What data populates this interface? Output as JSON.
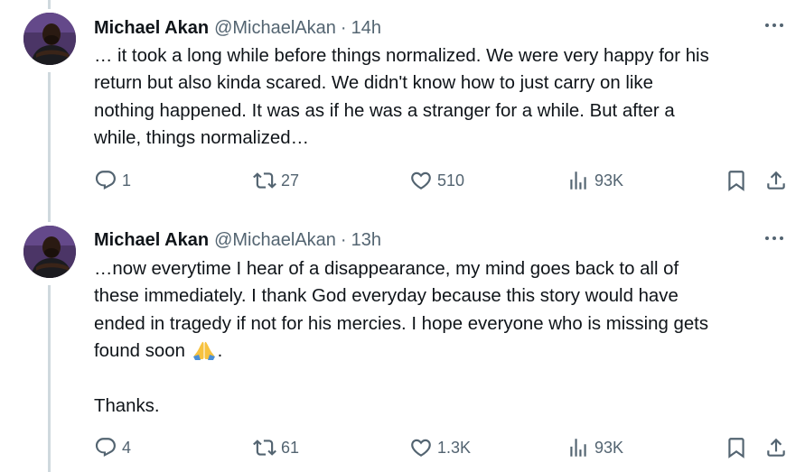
{
  "tweets": [
    {
      "name": "Michael Akan",
      "handle": "@MichaelAkan",
      "separator": "·",
      "time": "14h",
      "text_lines": [
        "… it took a long while before things normalized. We were very happy for his",
        "return but also kinda scared. We didn't know how to just carry on like",
        "nothing happened. It was as if he was a stranger for a while. But after a",
        "while, things normalized…"
      ],
      "replies": "1",
      "retweets": "27",
      "likes": "510",
      "views": "93K"
    },
    {
      "name": "Michael Akan",
      "handle": "@MichaelAkan",
      "separator": "·",
      "time": "13h",
      "text_lines": [
        "…now everytime I hear of a disappearance, my mind goes back to all of",
        "these immediately. I thank God everyday because this story would have",
        "ended in tragedy if not for his mercies. I hope everyone who is missing gets"
      ],
      "text_last_line_before_emoji": "found soon ",
      "emoji": "folded-hands-emoji",
      "text_last_line_after_emoji": ".",
      "closing": "Thanks.",
      "replies": "4",
      "retweets": "61",
      "likes": "1.3K",
      "views": "93K"
    }
  ],
  "icons": {
    "reply": "reply-icon",
    "retweet": "retweet-icon",
    "like": "heart-icon",
    "views": "views-icon",
    "bookmark": "bookmark-icon",
    "share": "share-icon",
    "more": "more-icon"
  },
  "colors": {
    "text_primary": "#0f1419",
    "text_secondary": "#536471",
    "thread_line": "#cfd9de"
  }
}
